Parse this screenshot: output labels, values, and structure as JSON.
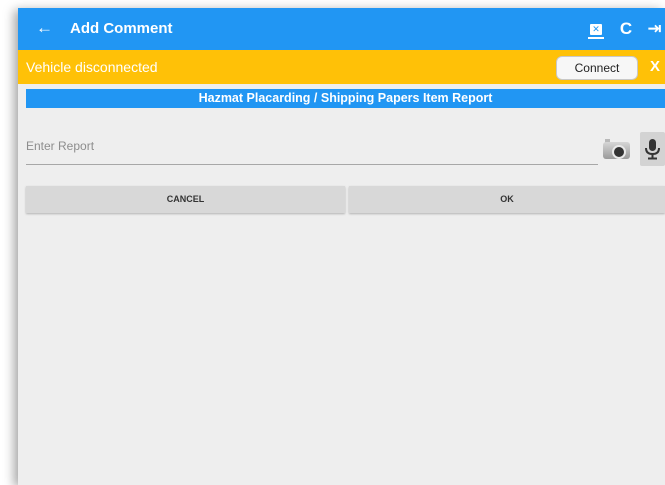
{
  "appbar": {
    "back_icon": "arrow-left-icon",
    "back_glyph": "←",
    "title": "Add Comment",
    "actions": [
      {
        "name": "device-icon",
        "glyph": "✕"
      },
      {
        "name": "refresh-icon",
        "glyph": "C"
      },
      {
        "name": "exit-icon",
        "glyph": "⇥"
      }
    ],
    "color": "#2196f3"
  },
  "banner": {
    "message": "Vehicle disconnected",
    "connect_label": "Connect",
    "close_label": "X",
    "color": "#ffc107"
  },
  "report": {
    "title": "Hazmat Placarding / Shipping Papers Item Report",
    "placeholder": "Enter Report",
    "value": "",
    "camera_icon": "camera-icon",
    "mic_icon": "microphone-icon"
  },
  "buttons": {
    "cancel_label": "CANCEL",
    "ok_label": "OK"
  }
}
